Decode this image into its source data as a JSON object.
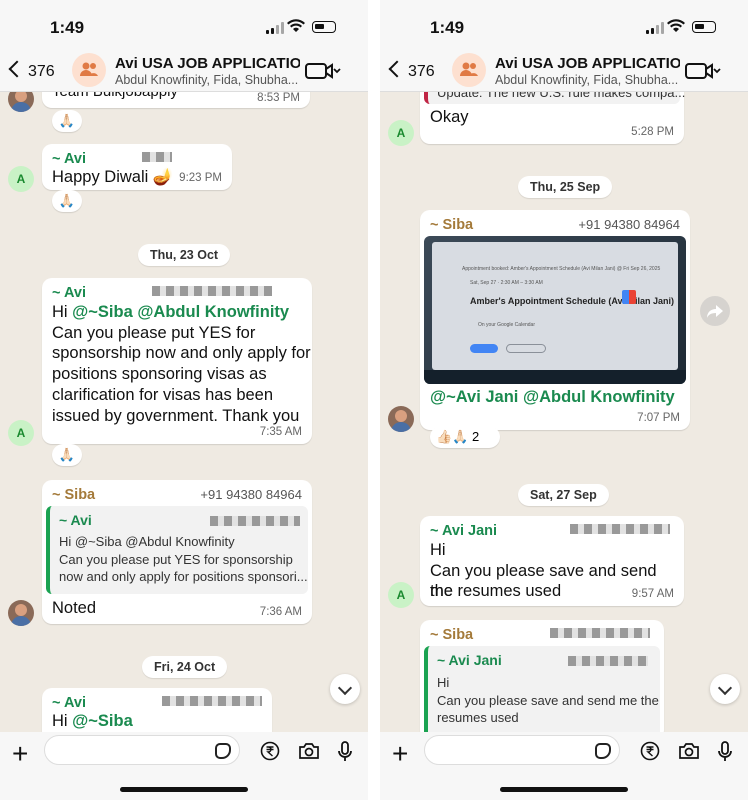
{
  "left": {
    "status_time": "1:49",
    "back_count": "376",
    "group_title": "Avi USA JOB APPLICATIO...",
    "group_subtitle": "Abdul Knowfinity, Fida, Shubha...",
    "messages": {
      "m0": {
        "text": "Team Bulkjobapply",
        "time": "8:53 PM"
      },
      "m1": {
        "sender": "~ Avi",
        "text": "Happy Diwali 🪔",
        "time": "9:23 PM",
        "avatar": "A"
      },
      "date1": "Thu, 23 Oct",
      "m2": {
        "sender": "~ Avi",
        "mention1": "@~Siba",
        "mention2": "@Abdul Knowfinity",
        "hi": "Hi ",
        "line1": "Can you please put YES for",
        "line2": "sponsorship now and only apply for",
        "line3": "positions sponsoring visas as",
        "line4": "clarification for visas has been",
        "line5": "issued by government. Thank you",
        "time": "7:35 AM",
        "avatar": "A"
      },
      "m3": {
        "sender": "~ Siba",
        "phone": "+91 94380 84964",
        "quote_sender": "~ Avi",
        "quote_line1": "Hi @~Siba @Abdul Knowfinity",
        "quote_line2": "Can you please put YES for sponsorship",
        "quote_line3": "now and only apply for positions sponsori...",
        "text": "Noted",
        "time": "7:36 AM"
      },
      "date2": "Fri, 24 Oct",
      "m4": {
        "sender": "~ Avi",
        "hi": "Hi ",
        "mention1": "@~Siba"
      }
    }
  },
  "right": {
    "status_time": "1:49",
    "back_count": "376",
    "group_title": "Avi USA JOB APPLICATIO...",
    "group_subtitle": "Abdul Knowfinity, Fida, Shubha...",
    "messages": {
      "r0": {
        "quote_text": "Update: The new U.S. rule makes compa...",
        "text": "Okay",
        "time": "5:28 PM",
        "avatar": "A"
      },
      "date1": "Thu, 25 Sep",
      "r1": {
        "sender": "~ Siba",
        "phone": "+91 94380 84964",
        "mention1": "@~Avi Jani",
        "mention2": "@Abdul Knowfinity",
        "time": "7:07 PM",
        "reaction": "👍🏻🙏🏻",
        "reaction_count": "2",
        "image_title": "Amber's Appointment Schedule (Avi Milan Jani)",
        "image_line1": "Appointment booked: Amber's Appointment Schedule (Avi Milan Jani) @ Fri Sep 26, 2025",
        "image_line2": "Sat, Sep 27 · 2:30 AM – 3:30 AM",
        "image_line3": "On your Google Calendar"
      },
      "date2": "Sat, 27 Sep",
      "r2": {
        "sender": "~ Avi Jani",
        "line1": "Hi",
        "line2": "Can you please save and send me",
        "line3": "the resumes used",
        "time": "9:57 AM",
        "avatar": "A"
      },
      "r3": {
        "sender": "~ Siba",
        "quote_sender": "~ Avi Jani",
        "quote_line1": "Hi",
        "quote_line2": "Can you please save and send me the",
        "quote_line3": "resumes used"
      }
    }
  },
  "colors": {
    "chat_bg": "#efeae2",
    "mention": "#1a8a4f",
    "siba": "#a47a3a",
    "avi": "#1a8a4f"
  },
  "icons": [
    "back-chevron-icon",
    "group-avatar-icon",
    "video-call-icon",
    "plus-icon",
    "sticker-icon",
    "rupee-icon",
    "camera-icon",
    "mic-icon",
    "scroll-down-icon",
    "forward-icon"
  ]
}
